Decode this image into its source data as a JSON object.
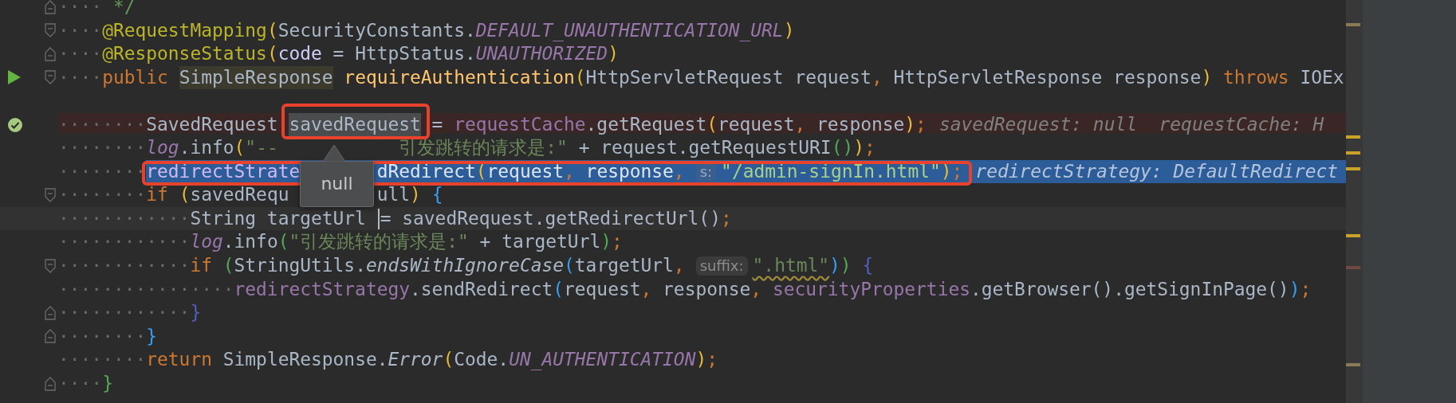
{
  "editor": {
    "lines": [
      {
        "kind": "normal",
        "fold": {
          "kind": "end"
        },
        "indent": "····",
        "tokens": [
          {
            "kind": "comment",
            "text": " */"
          }
        ]
      },
      {
        "kind": "normal",
        "fold": {
          "kind": "start"
        },
        "indent": "····",
        "tokens": [
          {
            "kind": "annotation",
            "text": "@RequestMapping"
          },
          {
            "kind": "b1",
            "text": "("
          },
          {
            "kind": "plain",
            "text": "SecurityConstants."
          },
          {
            "kind": "constant",
            "text": "DEFAULT_UNAUTHENTICATION_URL"
          },
          {
            "kind": "b1",
            "text": ")"
          }
        ]
      },
      {
        "kind": "normal",
        "fold": {
          "kind": "end"
        },
        "indent": "····",
        "tokens": [
          {
            "kind": "annotation",
            "text": "@ResponseStatus"
          },
          {
            "kind": "b1",
            "text": "("
          },
          {
            "kind": "named-arg",
            "text": "code"
          },
          {
            "kind": "plain",
            "text": " = HttpStatus."
          },
          {
            "kind": "constant",
            "text": "UNAUTHORIZED"
          },
          {
            "kind": "b1",
            "text": ")"
          }
        ]
      },
      {
        "kind": "normal",
        "gutter": {
          "kind": "run"
        },
        "fold": {
          "kind": "start"
        },
        "indent": "····",
        "tokens": [
          {
            "kind": "keyword",
            "text": "public "
          },
          {
            "kind": "plain",
            "text": "SimpleResponse",
            "highlight": {
              "kind": "usage"
            }
          },
          {
            "kind": "declaration",
            "text": " requireAuthentication"
          },
          {
            "kind": "b1",
            "text": "("
          },
          {
            "kind": "plain",
            "text": "HttpServletRequest request"
          },
          {
            "kind": "punct",
            "text": ","
          },
          {
            "kind": "plain",
            "text": " HttpServletResponse response"
          },
          {
            "kind": "b1",
            "text": ")"
          },
          {
            "kind": "keyword",
            "text": " throws"
          },
          {
            "kind": "plain",
            "text": " IOEx"
          }
        ]
      },
      {
        "kind": "normal"
      },
      {
        "kind": "breakpoint",
        "gutter": {
          "kind": "verified-breakpoint"
        },
        "indent": "········",
        "tokens": [
          {
            "kind": "plain",
            "text": "SavedRequest "
          },
          {
            "kind": "plain",
            "text": "savedRequest",
            "highlight": {
              "kind": "declaration"
            },
            "annotated": true
          },
          {
            "kind": "plain",
            "text": " = "
          },
          {
            "kind": "field",
            "text": "requestCache"
          },
          {
            "kind": "plain",
            "text": ".getRequest"
          },
          {
            "kind": "b1",
            "text": "("
          },
          {
            "kind": "plain",
            "text": "request"
          },
          {
            "kind": "punct",
            "text": ","
          },
          {
            "kind": "plain",
            "text": " response"
          },
          {
            "kind": "b1",
            "text": ")"
          },
          {
            "kind": "punct",
            "text": ";"
          },
          {
            "kind": "debug",
            "text": "savedRequest: null  requestCache: H"
          }
        ]
      },
      {
        "kind": "normal",
        "indent": "········",
        "tokens": [
          {
            "kind": "constant",
            "text": "log"
          },
          {
            "kind": "plain",
            "text": ".info"
          },
          {
            "kind": "b1",
            "text": "("
          },
          {
            "kind": "string",
            "text": "\"--"
          },
          {
            "kind": "covered"
          },
          {
            "kind": "string",
            "text": "引发跳转的请求是:\""
          },
          {
            "kind": "plain",
            "text": " + request.getRequestURI"
          },
          {
            "kind": "b2",
            "text": "()"
          },
          {
            "kind": "b1",
            "text": ")"
          },
          {
            "kind": "punct",
            "text": ";"
          }
        ]
      },
      {
        "kind": "current",
        "annotated": true,
        "indent": "········",
        "tokens": [
          {
            "kind": "field",
            "text": "redirectStrate"
          },
          {
            "kind": "popup",
            "text": "null"
          },
          {
            "kind": "plain",
            "text": "dRedirect"
          },
          {
            "kind": "b1",
            "text": "("
          },
          {
            "kind": "plain",
            "text": "request"
          },
          {
            "kind": "punct",
            "text": ","
          },
          {
            "kind": "plain",
            "text": " response"
          },
          {
            "kind": "punct",
            "text": ","
          },
          {
            "kind": "hint",
            "text": "s:"
          },
          {
            "kind": "string",
            "text": "\"/admin-signIn.html\""
          },
          {
            "kind": "b1",
            "text": ")"
          },
          {
            "kind": "punct",
            "text": ";"
          },
          {
            "kind": "debug",
            "text": "redirectStrategy: DefaultRedirect"
          }
        ]
      },
      {
        "kind": "normal",
        "fold": {
          "kind": "start"
        },
        "indent": "········",
        "tokens": [
          {
            "kind": "keyword",
            "text": "if "
          },
          {
            "kind": "b1",
            "text": "("
          },
          {
            "kind": "plain",
            "text": "savedRequ"
          },
          {
            "kind": "covered"
          },
          {
            "kind": "plain",
            "text": "ull"
          },
          {
            "kind": "b1",
            "text": ")"
          },
          {
            "kind": "b3",
            "text": " {"
          }
        ]
      },
      {
        "kind": "caret-line",
        "indent": "············",
        "tokens": [
          {
            "kind": "plain",
            "text": "String targetUrl "
          },
          {
            "kind": "caret"
          },
          {
            "kind": "plain",
            "text": "= savedRequest.getRedirectUrl()"
          },
          {
            "kind": "punct",
            "text": ";"
          }
        ]
      },
      {
        "kind": "normal",
        "indent": "············",
        "tokens": [
          {
            "kind": "constant",
            "text": "log"
          },
          {
            "kind": "plain",
            "text": ".info"
          },
          {
            "kind": "b2",
            "text": "("
          },
          {
            "kind": "string",
            "text": "\"引发跳转的请求是:\""
          },
          {
            "kind": "plain",
            "text": " + targetUrl"
          },
          {
            "kind": "b2",
            "text": ")"
          },
          {
            "kind": "punct",
            "text": ";"
          }
        ]
      },
      {
        "kind": "normal",
        "fold": {
          "kind": "start"
        },
        "indent": "············",
        "tokens": [
          {
            "kind": "keyword",
            "text": "if "
          },
          {
            "kind": "b2",
            "text": "("
          },
          {
            "kind": "plain",
            "text": "StringUtils."
          },
          {
            "kind": "static",
            "text": "endsWithIgnoreCase"
          },
          {
            "kind": "b3",
            "text": "("
          },
          {
            "kind": "plain",
            "text": "targetUrl"
          },
          {
            "kind": "punct",
            "text": ","
          },
          {
            "kind": "hint",
            "text": "suffix:"
          },
          {
            "kind": "string",
            "text": "\".html\"",
            "typo": true
          },
          {
            "kind": "b3",
            "text": ")"
          },
          {
            "kind": "b2",
            "text": ")"
          },
          {
            "kind": "b4",
            "text": " {"
          }
        ]
      },
      {
        "kind": "normal",
        "indent": "················",
        "tokens": [
          {
            "kind": "field",
            "text": "redirectStrategy"
          },
          {
            "kind": "plain",
            "text": ".sendRedirect"
          },
          {
            "kind": "b3",
            "text": "("
          },
          {
            "kind": "plain",
            "text": "request"
          },
          {
            "kind": "punct",
            "text": ","
          },
          {
            "kind": "plain",
            "text": " response"
          },
          {
            "kind": "punct",
            "text": ", "
          },
          {
            "kind": "field",
            "text": "securityProperties"
          },
          {
            "kind": "plain",
            "text": ".getBrowser().getSignInPage()"
          },
          {
            "kind": "b3",
            "text": ")"
          },
          {
            "kind": "punct",
            "text": ";"
          }
        ]
      },
      {
        "kind": "normal",
        "fold": {
          "kind": "end"
        },
        "indent": "············",
        "tokens": [
          {
            "kind": "b4",
            "text": "}"
          }
        ]
      },
      {
        "kind": "normal",
        "fold": {
          "kind": "end"
        },
        "indent": "········",
        "tokens": [
          {
            "kind": "b3",
            "text": "}"
          }
        ]
      },
      {
        "kind": "normal",
        "indent": "········",
        "tokens": [
          {
            "kind": "keyword",
            "text": "return "
          },
          {
            "kind": "plain",
            "text": "SimpleResponse."
          },
          {
            "kind": "static",
            "text": "Error"
          },
          {
            "kind": "b1",
            "text": "("
          },
          {
            "kind": "plain",
            "text": "Code."
          },
          {
            "kind": "constant",
            "text": "UN_AUTHENTICATION"
          },
          {
            "kind": "b1",
            "text": ")"
          },
          {
            "kind": "punct",
            "text": ";"
          }
        ]
      },
      {
        "kind": "normal",
        "fold": {
          "kind": "end"
        },
        "indent": "····",
        "tokens": [
          {
            "kind": "b2",
            "text": "}"
          }
        ]
      }
    ]
  }
}
